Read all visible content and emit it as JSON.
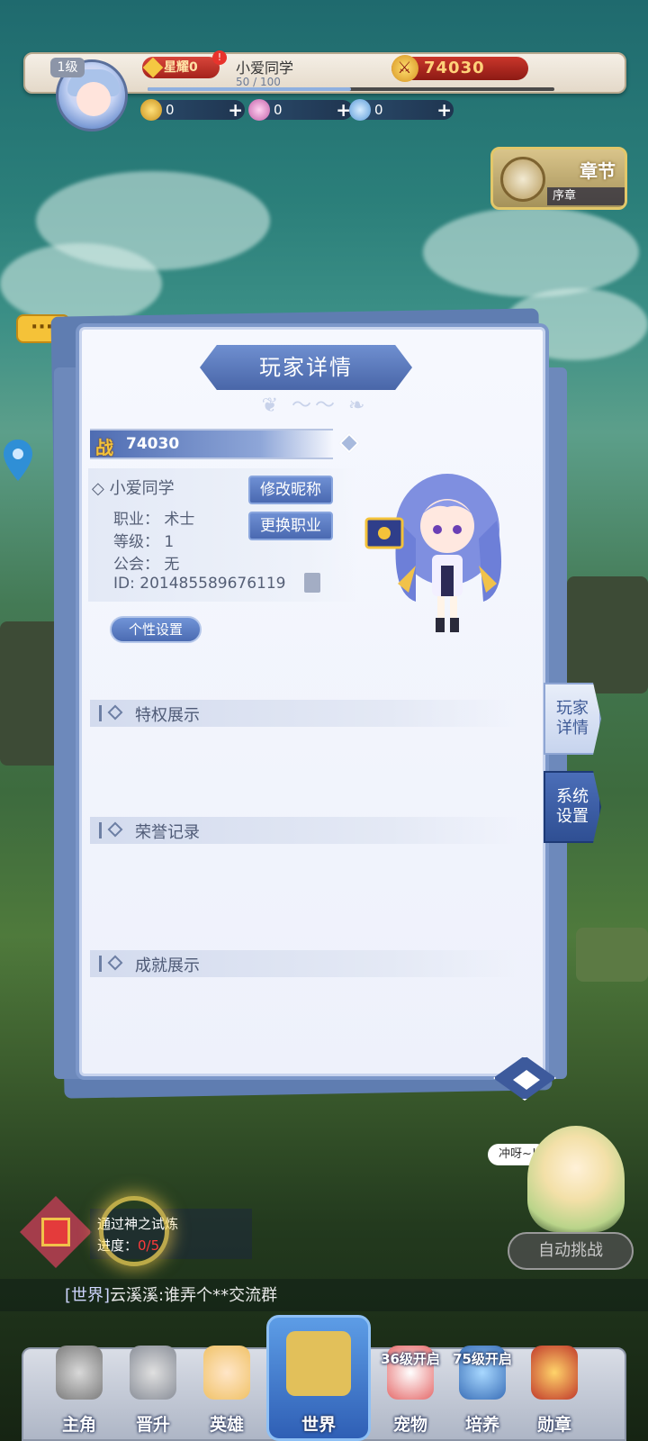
{
  "top": {
    "level": "1级",
    "title_badge": "星耀0",
    "notice_count": "!",
    "player_name": "小爱同学",
    "exp": "50 / 100",
    "exp_fraction": 0.5,
    "combat_power": "74030",
    "resources": [
      {
        "icon": "gold-coin-icon",
        "value": "0"
      },
      {
        "icon": "pink-gem-icon",
        "value": "0"
      },
      {
        "icon": "blue-gem-icon",
        "value": "0"
      }
    ]
  },
  "chapter": {
    "title": "章节",
    "sub": "序章"
  },
  "panel": {
    "title": "玩家详情",
    "power_label": "战",
    "power_value": "74030",
    "name": "小爱同学",
    "job_label": "职业：",
    "job_value": "术士",
    "level_label": "等级：",
    "level_value": "1",
    "guild_label": "公会：",
    "guild_value": "无",
    "id_label": "ID:",
    "id_value": "201485589676119",
    "btn_rename": "修改昵称",
    "btn_change_job": "更换职业",
    "btn_personal": "个性设置",
    "sections": [
      "特权展示",
      "荣誉记录",
      "成就展示"
    ]
  },
  "side_tabs": [
    {
      "label1": "玩家",
      "label2": "详情"
    },
    {
      "label1": "系统",
      "label2": "设置"
    }
  ],
  "trial": {
    "line1": "通过神之试炼",
    "progress_label": "进度：",
    "progress_value": "0/5"
  },
  "fairy_shout": "冲呀~!",
  "auto_button": "自动挑战",
  "chat": {
    "channel": "[世界]",
    "name": "云溪溪:",
    "message": "谁弄个**交流群"
  },
  "nav": [
    {
      "label": "主角",
      "icon": "knight-icon"
    },
    {
      "label": "晋升",
      "icon": "crossed-swords-icon"
    },
    {
      "label": "英雄",
      "icon": "hero-icon"
    },
    {
      "label": "世界",
      "icon": "world-map-icon"
    },
    {
      "label": "宠物",
      "icon": "fox-mask-icon",
      "lock": "36级开启"
    },
    {
      "label": "培养",
      "icon": "helmet-icon",
      "lock": "75级开启"
    },
    {
      "label": "勋章",
      "icon": "medal-icon"
    }
  ],
  "colors": {
    "accent": "#4a69b1",
    "power_red": "#c9362b",
    "gold": "#f3c23a"
  }
}
